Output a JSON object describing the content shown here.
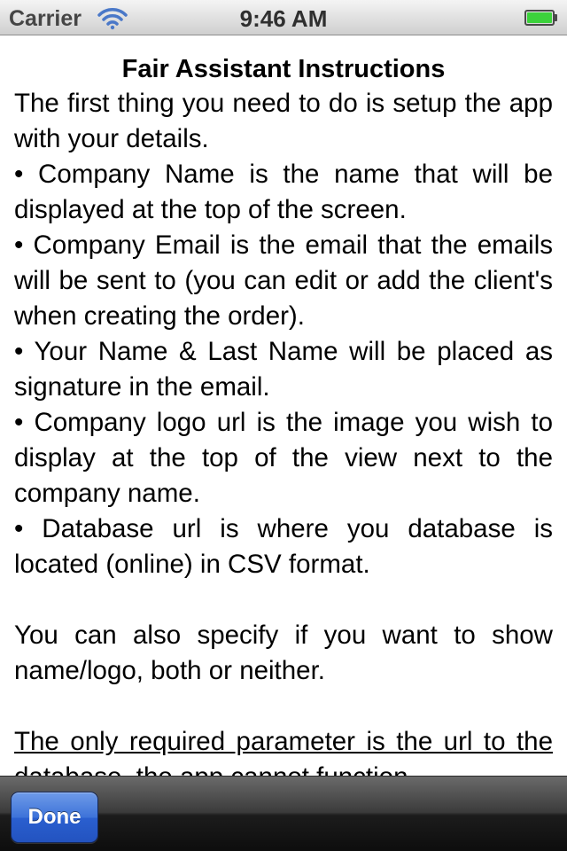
{
  "status_bar": {
    "carrier": "Carrier",
    "time": "9:46 AM",
    "battery_color": "#3cd23c"
  },
  "content": {
    "title": "Fair Assistant Instructions",
    "intro": "The first thing you need to do is setup the app with your details.",
    "bullets": [
      "• Company Name is the name that will be displayed at the top of the screen.",
      "• Company Email is the email that the emails will be sent to (you can edit or add the client's when creating the order).",
      "• Your Name & Last Name will be placed as signature in the email.",
      "• Company logo url is the image you wish to display at the top of the view next to the company name.",
      "• Database url is where you database is located (online) in CSV format."
    ],
    "note": "You can also specify if you want to show name/logo, both or neither.",
    "required": "The only required parameter is the url to the database, the app cannot function"
  },
  "toolbar": {
    "done_label": "Done",
    "accent": "#2f66d6"
  }
}
